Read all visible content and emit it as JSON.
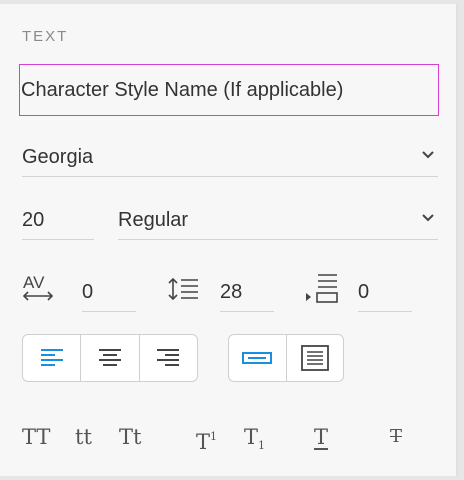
{
  "panel": {
    "section_title": "TEXT",
    "character_style_name": "Character Style Name (If applicable)",
    "font_family": "Georgia",
    "font_size": "20",
    "font_weight": "Regular",
    "letter_spacing": "0",
    "line_height": "28",
    "paragraph_spacing": "0",
    "align_options": [
      "align-left",
      "align-center",
      "align-right"
    ],
    "align_selected": "align-left",
    "text_box_options": [
      "auto-width",
      "fixed-size"
    ],
    "text_box_selected": "auto-width",
    "transform_buttons": {
      "uppercase": "TT",
      "lowercase": "tt",
      "titlecase": "Tt",
      "superscript_base": "T",
      "superscript_mark": "1",
      "subscript_base": "T",
      "subscript_mark": "1",
      "underline": "T",
      "strikethrough": "T"
    },
    "colors": {
      "accent": "#1a8fe0",
      "highlight_border": "#d63fd6",
      "text": "#333333",
      "muted": "#8a8a8a"
    }
  }
}
